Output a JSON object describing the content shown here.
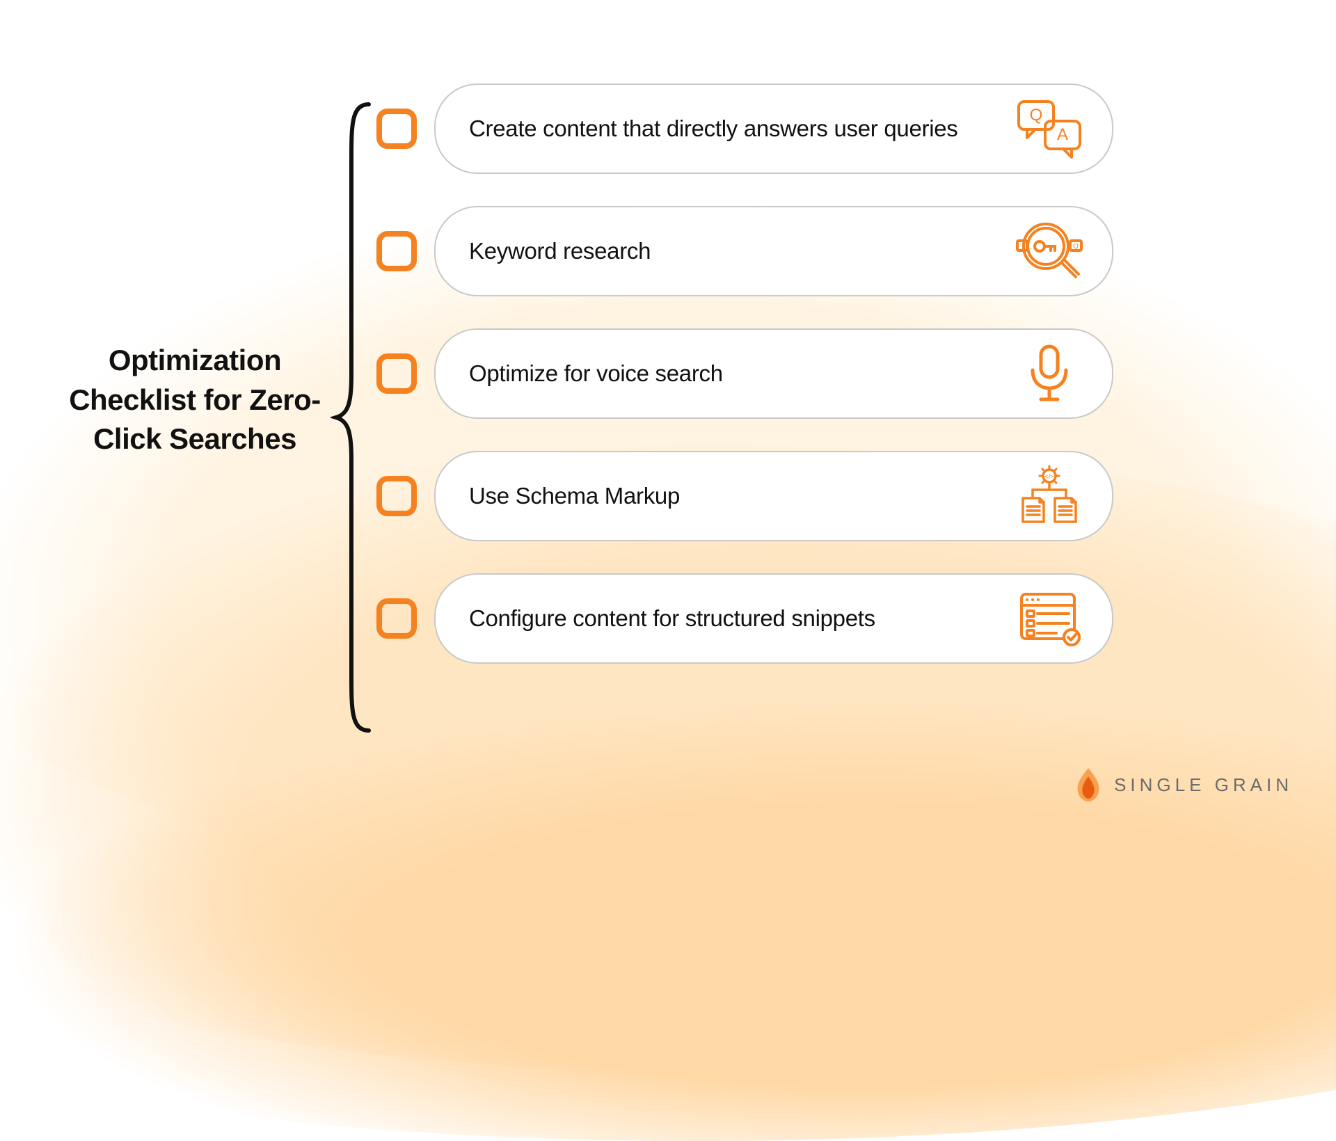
{
  "title": "Optimization Checklist for Zero-Click Searches",
  "items": [
    {
      "label": "Create content that directly answers user queries",
      "icon": "qa-bubbles-icon"
    },
    {
      "label": "Keyword research",
      "icon": "search-key-icon"
    },
    {
      "label": "Optimize for voice search",
      "icon": "microphone-icon"
    },
    {
      "label": "Use Schema Markup",
      "icon": "schema-docs-icon"
    },
    {
      "label": "Configure content for structured snippets",
      "icon": "snippet-checklist-icon"
    }
  ],
  "brand": "SINGLE GRAIN",
  "colors": {
    "accent": "#f58220",
    "accent_light": "#f9a14e",
    "text": "#111111",
    "pill_border": "#c9c9c9"
  }
}
